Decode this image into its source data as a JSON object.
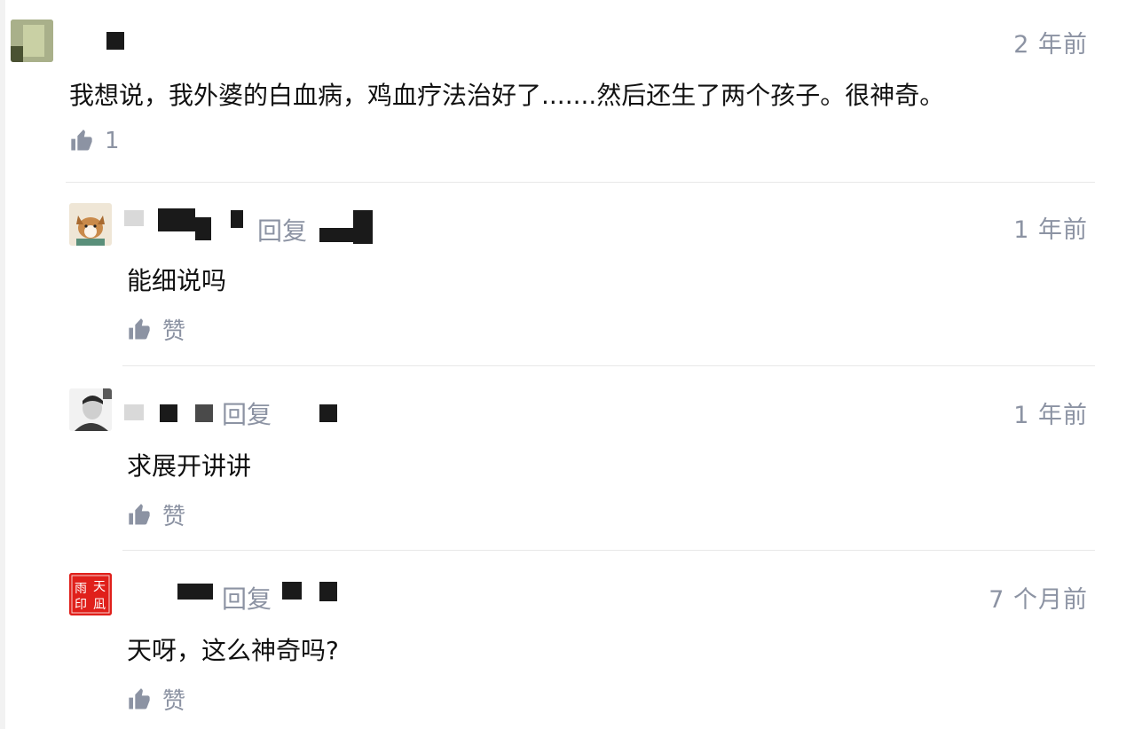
{
  "comments": [
    {
      "time": "2 年前",
      "text": "我想说，我外婆的白血病，鸡血疗法治好了.......然后还生了两个孩子。很神奇。",
      "likes": "1"
    },
    {
      "reply_label": "回复",
      "time": "1 年前",
      "text": "能细说吗",
      "likes": "赞"
    },
    {
      "reply_label": "回复",
      "time": "1 年前",
      "text": "求展开讲讲",
      "likes": "赞"
    },
    {
      "reply_label": "回复",
      "time": "7 个月前",
      "text": "天呀，这么神奇吗?",
      "likes": "赞",
      "avatar_text": [
        "雨",
        "天",
        "印",
        "凪"
      ]
    }
  ],
  "colors": {
    "meta_gray": "#8c93a3",
    "text": "#111111",
    "divider": "#e8e8e8",
    "seal_red": "#e0201b"
  },
  "icons": {
    "like": "thumbs-up-icon"
  }
}
